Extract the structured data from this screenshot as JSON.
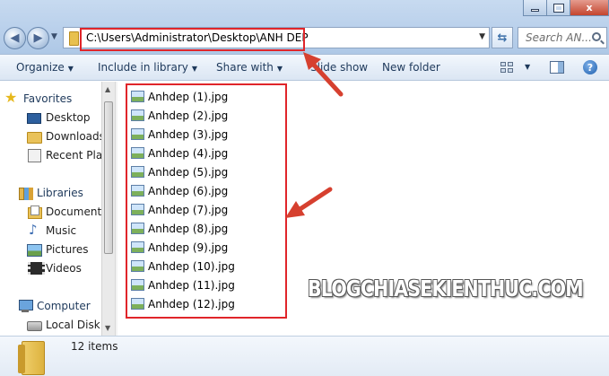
{
  "window": {
    "minimize_icon": "minimize-icon",
    "maximize_icon": "maximize-icon",
    "close_label": "x"
  },
  "address": {
    "path": "C:\\Users\\Administrator\\Desktop\\ANH DEP"
  },
  "search": {
    "placeholder": "Search AN..."
  },
  "toolbar": {
    "organize": "Organize",
    "include_in_library": "Include in library",
    "share_with": "Share with",
    "slide_show": "Slide show",
    "new_folder": "New folder",
    "help": "?"
  },
  "nav": {
    "favorites": "Favorites",
    "desktop": "Desktop",
    "downloads": "Downloads",
    "recent_places": "Recent Places",
    "libraries": "Libraries",
    "documents": "Documents",
    "music": "Music",
    "pictures": "Pictures",
    "videos": "Videos",
    "computer": "Computer",
    "local_disk": "Local Disk"
  },
  "files": [
    "Anhdep (1).jpg",
    "Anhdep (2).jpg",
    "Anhdep (3).jpg",
    "Anhdep (4).jpg",
    "Anhdep (5).jpg",
    "Anhdep (6).jpg",
    "Anhdep (7).jpg",
    "Anhdep (8).jpg",
    "Anhdep (9).jpg",
    "Anhdep (10).jpg",
    "Anhdep (11).jpg",
    "Anhdep (12).jpg"
  ],
  "status": {
    "item_count": "12 items"
  },
  "watermark": "BLOGCHIASEKIENTHUC.COM",
  "colors": {
    "annotation_red": "#e0252a",
    "aero_blue": "#bcd2ec"
  }
}
